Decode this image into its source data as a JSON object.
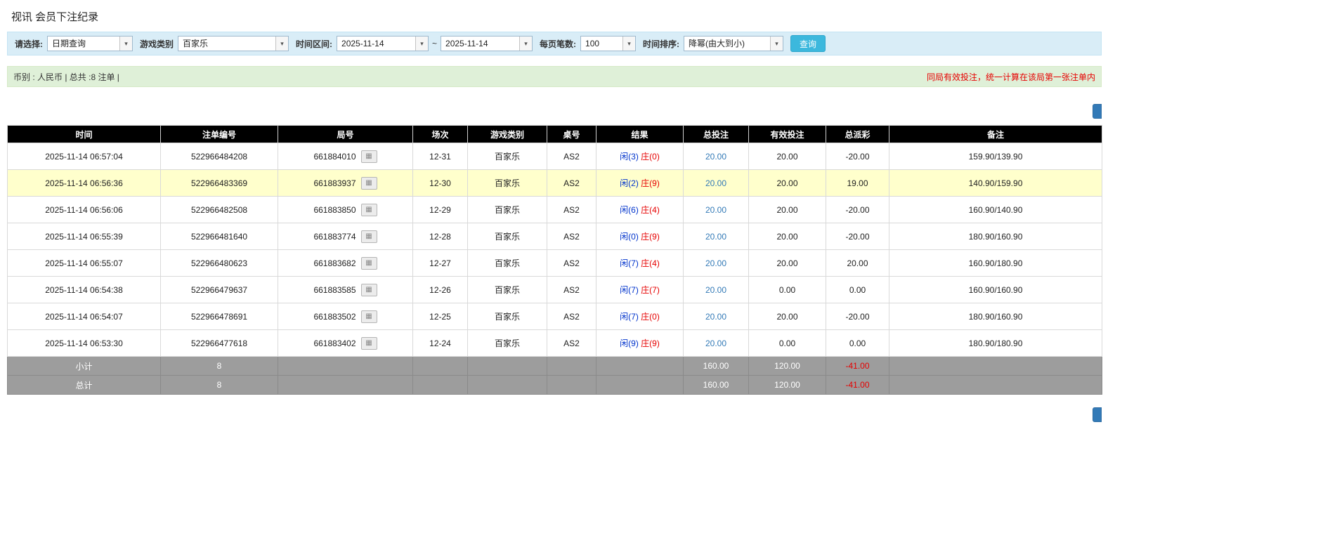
{
  "colors": {
    "accent_blue": "#3cb8dd",
    "link_blue": "#337ab7",
    "negative_red": "#e60000",
    "player_blue": "#0033cc",
    "banker_red": "#e60000",
    "highlight_yellow": "#ffffcc",
    "filter_bar_bg": "#d9edf7",
    "notice_bar_bg": "#dff0d8",
    "header_bg": "#000000",
    "summary_bg": "#9d9d9d"
  },
  "icons": {
    "combo_arrow": "▾",
    "video_replay": "▦"
  },
  "page": {
    "title": "视讯 会员下注纪录"
  },
  "filters": {
    "select_label": "请选择:",
    "select_value": "日期查询",
    "game_type_label": "游戏类别",
    "game_type_value": "百家乐",
    "date_range_label": "时间区间:",
    "date_from": "2025-11-14",
    "date_separator": "~",
    "date_to": "2025-11-14",
    "page_size_label": "每页笔数:",
    "page_size_value": "100",
    "sort_label": "时间排序:",
    "sort_value": "降幂(由大到小)",
    "search_button": "查询"
  },
  "notice_bar": {
    "left_text": "币别 : 人民币 | 总共 :8 注单 |",
    "right_text": "同局有效投注，统一计算在该局第一张注单内"
  },
  "table": {
    "headers": [
      "时间",
      "注单编号",
      "局号",
      "场次",
      "游戏类别",
      "桌号",
      "结果",
      "总投注",
      "有效投注",
      "总派彩",
      "备注"
    ],
    "rows": [
      {
        "time": "2025-11-14 06:57:04",
        "bet_id": "522966484208",
        "round_id": "661884010",
        "session": "12-31",
        "game": "百家乐",
        "table_no": "AS2",
        "result_player": "闲(3)",
        "result_banker": "庄(0)",
        "total_bet": "20.00",
        "valid_bet": "20.00",
        "payout": "-20.00",
        "note": "159.90/139.90",
        "highlighted": false
      },
      {
        "time": "2025-11-14 06:56:36",
        "bet_id": "522966483369",
        "round_id": "661883937",
        "session": "12-30",
        "game": "百家乐",
        "table_no": "AS2",
        "result_player": "闲(2)",
        "result_banker": "庄(9)",
        "total_bet": "20.00",
        "valid_bet": "20.00",
        "payout": "19.00",
        "note": "140.90/159.90",
        "highlighted": true
      },
      {
        "time": "2025-11-14 06:56:06",
        "bet_id": "522966482508",
        "round_id": "661883850",
        "session": "12-29",
        "game": "百家乐",
        "table_no": "AS2",
        "result_player": "闲(6)",
        "result_banker": "庄(4)",
        "total_bet": "20.00",
        "valid_bet": "20.00",
        "payout": "-20.00",
        "note": "160.90/140.90",
        "highlighted": false
      },
      {
        "time": "2025-11-14 06:55:39",
        "bet_id": "522966481640",
        "round_id": "661883774",
        "session": "12-28",
        "game": "百家乐",
        "table_no": "AS2",
        "result_player": "闲(0)",
        "result_banker": "庄(9)",
        "total_bet": "20.00",
        "valid_bet": "20.00",
        "payout": "-20.00",
        "note": "180.90/160.90",
        "highlighted": false
      },
      {
        "time": "2025-11-14 06:55:07",
        "bet_id": "522966480623",
        "round_id": "661883682",
        "session": "12-27",
        "game": "百家乐",
        "table_no": "AS2",
        "result_player": "闲(7)",
        "result_banker": "庄(4)",
        "total_bet": "20.00",
        "valid_bet": "20.00",
        "payout": "20.00",
        "note": "160.90/180.90",
        "highlighted": false
      },
      {
        "time": "2025-11-14 06:54:38",
        "bet_id": "522966479637",
        "round_id": "661883585",
        "session": "12-26",
        "game": "百家乐",
        "table_no": "AS2",
        "result_player": "闲(7)",
        "result_banker": "庄(7)",
        "total_bet": "20.00",
        "valid_bet": "0.00",
        "payout": "0.00",
        "note": "160.90/160.90",
        "highlighted": false
      },
      {
        "time": "2025-11-14 06:54:07",
        "bet_id": "522966478691",
        "round_id": "661883502",
        "session": "12-25",
        "game": "百家乐",
        "table_no": "AS2",
        "result_player": "闲(7)",
        "result_banker": "庄(0)",
        "total_bet": "20.00",
        "valid_bet": "20.00",
        "payout": "-20.00",
        "note": "180.90/160.90",
        "highlighted": false
      },
      {
        "time": "2025-11-14 06:53:30",
        "bet_id": "522966477618",
        "round_id": "661883402",
        "session": "12-24",
        "game": "百家乐",
        "table_no": "AS2",
        "result_player": "闲(9)",
        "result_banker": "庄(9)",
        "total_bet": "20.00",
        "valid_bet": "0.00",
        "payout": "0.00",
        "note": "180.90/180.90",
        "highlighted": false
      }
    ],
    "summary_rows": [
      {
        "label": "小计",
        "count": "8",
        "total_bet": "160.00",
        "valid_bet": "120.00",
        "payout": "-41.00"
      },
      {
        "label": "总计",
        "count": "8",
        "total_bet": "160.00",
        "valid_bet": "120.00",
        "payout": "-41.00"
      }
    ]
  }
}
